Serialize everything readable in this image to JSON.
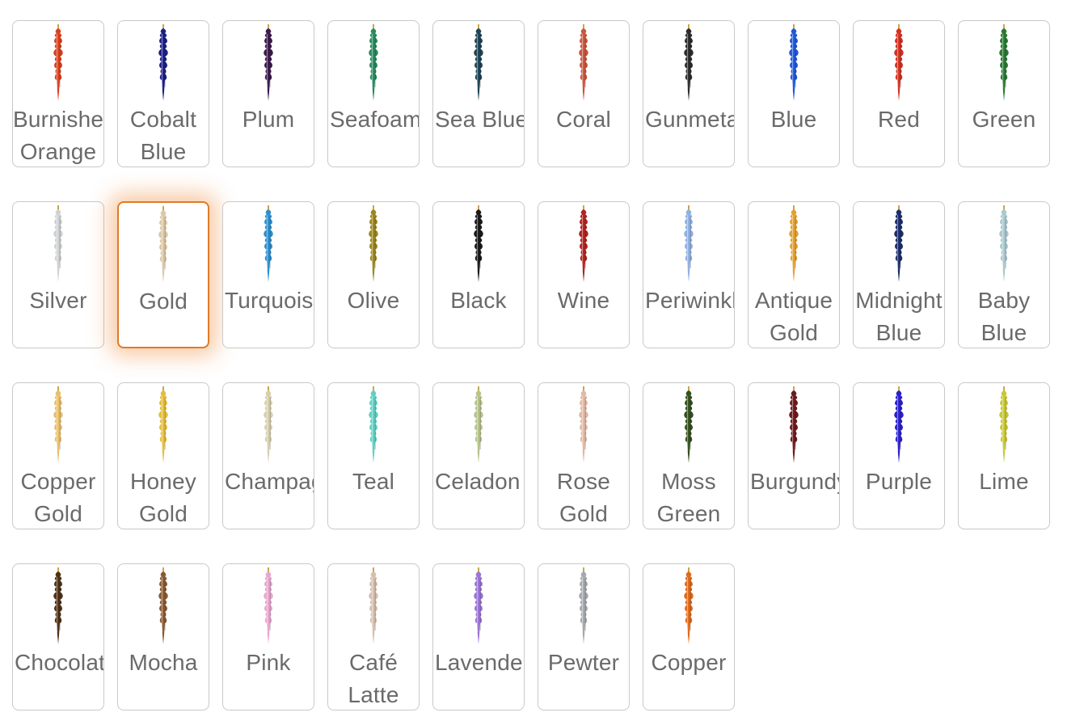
{
  "swatches": [
    {
      "label": "Burnished Orange",
      "color": "#d9431f",
      "nowrap": false,
      "selected": false
    },
    {
      "label": "Cobalt Blue",
      "color": "#1d1f86",
      "nowrap": false,
      "selected": false
    },
    {
      "label": "Plum",
      "color": "#3d1a4f",
      "nowrap": false,
      "selected": false
    },
    {
      "label": "Seafoam",
      "color": "#2a8a5e",
      "nowrap": true,
      "selected": false
    },
    {
      "label": "Sea Blue",
      "color": "#1f4556",
      "nowrap": true,
      "selected": false
    },
    {
      "label": "Coral",
      "color": "#c8573e",
      "nowrap": false,
      "selected": false
    },
    {
      "label": "Gunmetal",
      "color": "#2e2b2b",
      "nowrap": true,
      "selected": false
    },
    {
      "label": "Blue",
      "color": "#2158d8",
      "nowrap": false,
      "selected": false
    },
    {
      "label": "Red",
      "color": "#d5301f",
      "nowrap": false,
      "selected": false
    },
    {
      "label": "Green",
      "color": "#2a7a33",
      "nowrap": false,
      "selected": false
    },
    {
      "label": "Silver",
      "color": "#cfd1d3",
      "nowrap": false,
      "selected": false
    },
    {
      "label": "Gold",
      "color": "#dcc8a4",
      "nowrap": false,
      "selected": true
    },
    {
      "label": "Turquoise",
      "color": "#2d8fcf",
      "nowrap": true,
      "selected": false
    },
    {
      "label": "Olive",
      "color": "#9b861d",
      "nowrap": false,
      "selected": false
    },
    {
      "label": "Black",
      "color": "#1a1a1a",
      "nowrap": false,
      "selected": false
    },
    {
      "label": "Wine",
      "color": "#b02520",
      "nowrap": false,
      "selected": false
    },
    {
      "label": "Periwinkle",
      "color": "#8fb0e3",
      "nowrap": true,
      "selected": false
    },
    {
      "label": "Antique Gold",
      "color": "#e3a032",
      "nowrap": false,
      "selected": false
    },
    {
      "label": "Midnight Blue",
      "color": "#1b2d6b",
      "nowrap": false,
      "selected": false
    },
    {
      "label": "Baby Blue",
      "color": "#a9c8cf",
      "nowrap": false,
      "selected": false
    },
    {
      "label": "Copper Gold",
      "color": "#e8c06a",
      "nowrap": false,
      "selected": false
    },
    {
      "label": "Honey Gold",
      "color": "#e6bd3c",
      "nowrap": false,
      "selected": false
    },
    {
      "label": "Champagne",
      "color": "#d6cfae",
      "nowrap": true,
      "selected": false
    },
    {
      "label": "Teal",
      "color": "#5fd0c2",
      "nowrap": false,
      "selected": false
    },
    {
      "label": "Celadon",
      "color": "#b6c48a",
      "nowrap": true,
      "selected": false
    },
    {
      "label": "Rose Gold",
      "color": "#e2b9a3",
      "nowrap": false,
      "selected": false
    },
    {
      "label": "Moss Green",
      "color": "#35501f",
      "nowrap": false,
      "selected": false
    },
    {
      "label": "Burgundy",
      "color": "#6e1a1e",
      "nowrap": true,
      "selected": false
    },
    {
      "label": "Purple",
      "color": "#2a1fd0",
      "nowrap": false,
      "selected": false
    },
    {
      "label": "Lime",
      "color": "#c9c734",
      "nowrap": false,
      "selected": false
    },
    {
      "label": "Chocolate",
      "color": "#4f3216",
      "nowrap": true,
      "selected": false
    },
    {
      "label": "Mocha",
      "color": "#8a5b32",
      "nowrap": false,
      "selected": false
    },
    {
      "label": "Pink",
      "color": "#e8a6cf",
      "nowrap": false,
      "selected": false
    },
    {
      "label": "Café Latte",
      "color": "#d5bfae",
      "nowrap": false,
      "selected": false
    },
    {
      "label": "Lavender",
      "color": "#9a74d6",
      "nowrap": true,
      "selected": false
    },
    {
      "label": "Pewter",
      "color": "#a5a8ad",
      "nowrap": false,
      "selected": false
    },
    {
      "label": "Copper",
      "color": "#e06a18",
      "nowrap": false,
      "selected": false
    }
  ]
}
